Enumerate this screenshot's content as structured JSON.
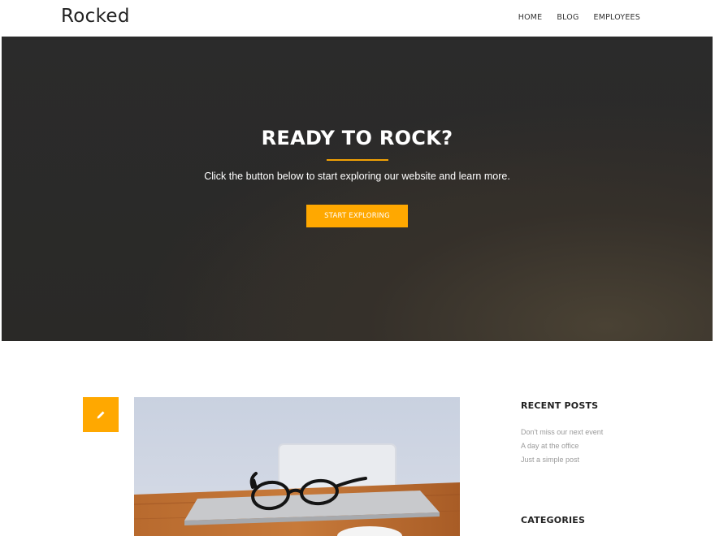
{
  "header": {
    "site_title": "Rocked",
    "nav": [
      "HOME",
      "BLOG",
      "EMPLOYEES"
    ]
  },
  "hero": {
    "title": "READY TO ROCK?",
    "subtitle": "Click the button below to start exploring our website and learn more.",
    "button_label": "START EXPLORING"
  },
  "post": {
    "format_icon": "pencil-icon"
  },
  "sidebar": {
    "recent_posts_title": "RECENT POSTS",
    "recent_posts": [
      "Don't miss our next event",
      "A day at the office",
      "Just a simple post"
    ],
    "categories_title": "CATEGORIES"
  },
  "colors": {
    "accent": "#ffa800",
    "hero_background": "#2b2b2b",
    "text_dark": "#222222",
    "text_muted": "#9a9a9a"
  }
}
